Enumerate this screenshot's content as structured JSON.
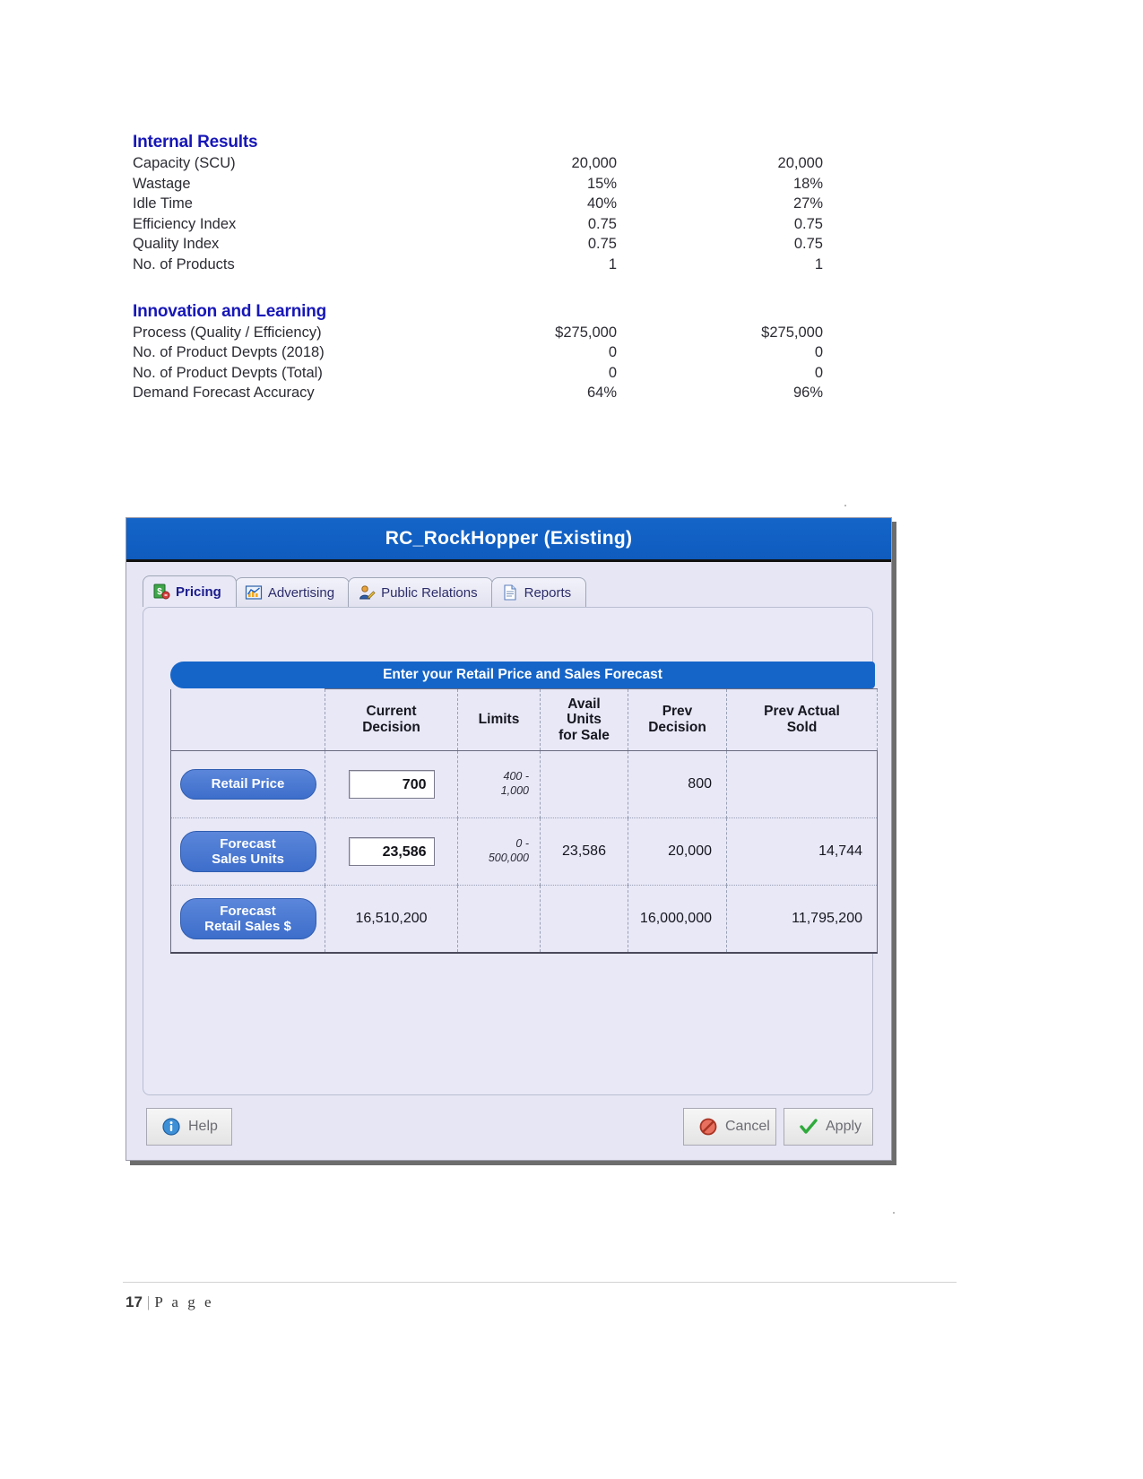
{
  "report": {
    "sections": [
      {
        "title": "Internal Results",
        "rows": [
          {
            "label": "Capacity (SCU)",
            "col1": "20,000",
            "col2": "20,000"
          },
          {
            "label": "Wastage",
            "col1": "15%",
            "col2": "18%"
          },
          {
            "label": "Idle Time",
            "col1": "40%",
            "col2": "27%"
          },
          {
            "label": "Efficiency Index",
            "col1": "0.75",
            "col2": "0.75"
          },
          {
            "label": "Quality Index",
            "col1": "0.75",
            "col2": "0.75"
          },
          {
            "label": "No. of Products",
            "col1": "1",
            "col2": "1"
          }
        ]
      },
      {
        "title": "Innovation and Learning",
        "rows": [
          {
            "label": "Process (Quality / Efficiency)",
            "col1": "$275,000",
            "col2": "$275,000"
          },
          {
            "label": "No. of Product Devpts (2018)",
            "col1": "0",
            "col2": "0"
          },
          {
            "label": "No. of Product Devpts (Total)",
            "col1": "0",
            "col2": "0"
          },
          {
            "label": "Demand Forecast Accuracy",
            "col1": "64%",
            "col2": "96%"
          }
        ]
      }
    ]
  },
  "dialog": {
    "title": "RC_RockHopper (Existing)",
    "tabs": [
      {
        "label": "Pricing",
        "icon": "pricing-icon",
        "active": true
      },
      {
        "label": "Advertising",
        "icon": "advertising-chart-icon",
        "active": false
      },
      {
        "label": "Public Relations",
        "icon": "public-relations-icon",
        "active": false
      },
      {
        "label": "Reports",
        "icon": "reports-document-icon",
        "active": false
      }
    ],
    "banner": "Enter your Retail Price and Sales Forecast",
    "table": {
      "headers": [
        "",
        "Current\nDecision",
        "Limits",
        "Avail\nUnits\nfor Sale",
        "Prev\nDecision",
        "Prev Actual\nSold"
      ],
      "header_current_decision": "Current",
      "header_current_decision_2": "Decision",
      "header_limits": "Limits",
      "header_avail_1": "Avail",
      "header_avail_2": "Units",
      "header_avail_3": "for Sale",
      "header_prev_1": "Prev",
      "header_prev_2": "Decision",
      "header_prevactual_1": "Prev Actual",
      "header_prevactual_2": "Sold",
      "rows": [
        {
          "label": "Retail Price",
          "label_line1": "Retail Price",
          "label_line2": "",
          "current_decision": "700",
          "is_input": true,
          "limits_min": "400 -",
          "limits_max": "1,000",
          "avail_units": "",
          "prev_decision": "800",
          "prev_actual_sold": ""
        },
        {
          "label": "Forecast Sales Units",
          "label_line1": "Forecast",
          "label_line2": "Sales Units",
          "current_decision": "23,586",
          "is_input": true,
          "limits_min": "0 -",
          "limits_max": "500,000",
          "avail_units": "23,586",
          "prev_decision": "20,000",
          "prev_actual_sold": "14,744"
        },
        {
          "label": "Forecast Retail Sales $",
          "label_line1": "Forecast",
          "label_line2": "Retail Sales $",
          "current_decision": "16,510,200",
          "is_input": false,
          "limits_min": "",
          "limits_max": "",
          "avail_units": "",
          "prev_decision": "16,000,000",
          "prev_actual_sold": "11,795,200"
        }
      ]
    },
    "buttons": {
      "help": "Help",
      "cancel": "Cancel",
      "apply": "Apply"
    }
  },
  "page_footer": {
    "number": "17",
    "separator": "|",
    "word": "P a g e"
  },
  "colors": {
    "title_blue": "#1464c8",
    "heading_blue": "#1717b8",
    "banner_blue": "#1565c9",
    "pill_blue": "#3d6ecb",
    "panel_bg": "#e8e8f7"
  }
}
